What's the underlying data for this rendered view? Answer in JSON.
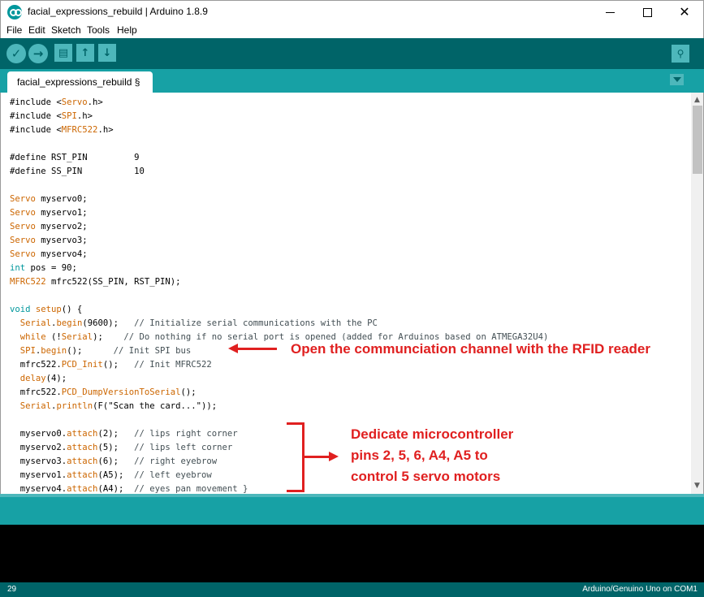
{
  "window": {
    "title": "facial_expressions_rebuild | Arduino 1.8.9",
    "minimize_label": "",
    "maximize_label": "",
    "close_label": "✕"
  },
  "menu": {
    "items": [
      "File",
      "Edit",
      "Sketch",
      "Tools",
      "Help"
    ]
  },
  "toolbar": {
    "buttons": [
      {
        "name": "verify-icon",
        "glyph": "✓"
      },
      {
        "name": "upload-icon",
        "glyph": "→"
      },
      {
        "name": "new-icon",
        "glyph": "▤"
      },
      {
        "name": "open-icon",
        "glyph": "↑"
      },
      {
        "name": "save-icon",
        "glyph": "↓"
      }
    ],
    "serial_monitor_glyph": "⚲"
  },
  "tab": {
    "label": "facial_expressions_rebuild §"
  },
  "annotations": {
    "spi": "Open the communciation channel with the RFID reader",
    "servo_line1": "Dedicate microcontroller",
    "servo_line2": "pins 2, 5, 6, A4, A5 to",
    "servo_line3": "control 5 servo motors"
  },
  "status": {
    "line_number": "29",
    "board": "Arduino/Genuino Uno on COM1"
  },
  "colors": {
    "toolbar": "#006468",
    "tabstrip": "#17a1a5",
    "accent": "#4db7bb",
    "annotation": "#e02020"
  }
}
